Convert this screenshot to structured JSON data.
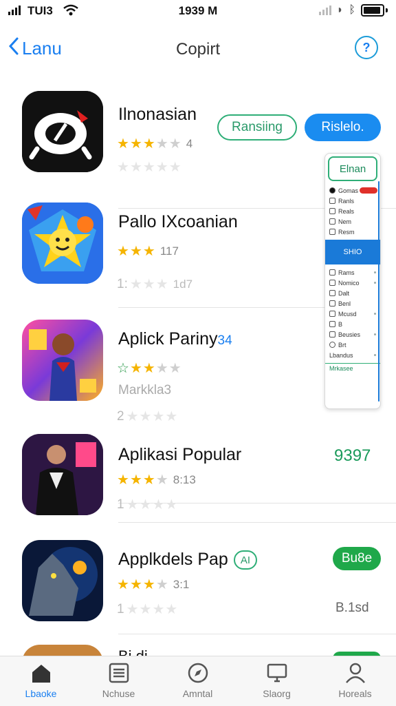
{
  "status": {
    "carrier": "TUI3",
    "time": "1939 M"
  },
  "nav": {
    "back_label": "Lanu",
    "title": "Copirt",
    "help_icon": "?"
  },
  "apps": [
    {
      "title": "Ilnonasian",
      "rating": 3,
      "rating_text": "4",
      "sub": "",
      "action1": "Ransiing",
      "action2": "Rislelo."
    },
    {
      "title": "Pallo IXcoanian",
      "rating": 3,
      "rating_text": "117",
      "sub": "1:",
      "sub2": "1d7"
    },
    {
      "title": "Aplick Pariny",
      "title_suffix": "34",
      "rating": 2,
      "rating_text": "",
      "sub": "Markkla3",
      "sub3": "2"
    },
    {
      "title": "Aplikasi Popular",
      "rating": 3,
      "rating_text": "8:13",
      "sub": "1",
      "price": "9397"
    },
    {
      "title": "Applkdels Pap",
      "tag": "AI",
      "rating": 3,
      "rating_text": "3:1",
      "sub": "1",
      "action": "Bu8e",
      "meta": "B.1sd"
    }
  ],
  "peek": {
    "title": "Bi di"
  },
  "panel": {
    "header": "Elnan",
    "items": [
      "Gomas",
      "Ranls",
      "Reals",
      "Nem",
      "Resm",
      "Rams",
      "Nomico",
      "Dalt",
      "Benl",
      "Mcusd",
      "B",
      "Beusies",
      "Brt",
      "Lbandus"
    ],
    "highlight": "SHIO",
    "footer": "Mrkasee"
  },
  "tabs": [
    {
      "label": "Lbaoke",
      "icon": "home-icon"
    },
    {
      "label": "Nchuse",
      "icon": "list-icon"
    },
    {
      "label": "Amntal",
      "icon": "compass-icon"
    },
    {
      "label": "Slaorg",
      "icon": "monitor-icon"
    },
    {
      "label": "Horeals",
      "icon": "person-icon"
    }
  ],
  "colors": {
    "accent": "#1a7ff0",
    "green": "#1fa84a",
    "star": "#f5b400"
  }
}
